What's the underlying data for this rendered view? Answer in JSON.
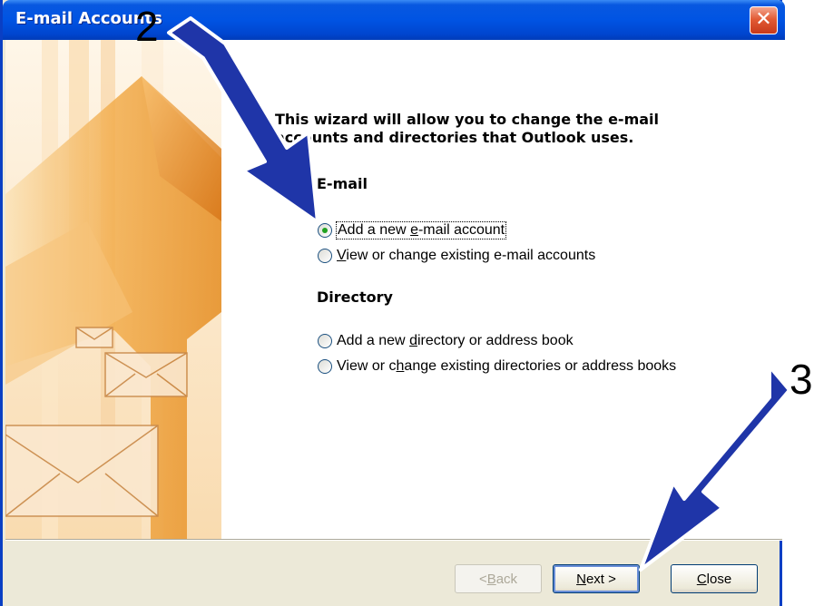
{
  "window": {
    "title": "E-mail Accounts",
    "close_glyph": "✕"
  },
  "intro": {
    "line1": "This wizard will allow you to change the e-mail",
    "line2": "accounts and directories that Outlook uses."
  },
  "email_group": {
    "title": "E-mail",
    "options": [
      {
        "before": "Add a new ",
        "mnemonic": "e",
        "after": "-mail account",
        "checked": true
      },
      {
        "before": "",
        "mnemonic": "V",
        "after": "iew or change existing e-mail accounts",
        "checked": false
      }
    ]
  },
  "directory_group": {
    "title": "Directory",
    "options": [
      {
        "before": "Add a new ",
        "mnemonic": "d",
        "after": "irectory or address book",
        "checked": false
      },
      {
        "before": "View or c",
        "mnemonic": "h",
        "after": "ange existing directories or address books",
        "checked": false
      }
    ]
  },
  "buttons": {
    "back": {
      "before": "< ",
      "mnemonic": "B",
      "after": "ack",
      "enabled": false
    },
    "next": {
      "before": "",
      "mnemonic": "N",
      "after": "ext >",
      "enabled": true
    },
    "close": {
      "before": "",
      "mnemonic": "C",
      "after": "lose",
      "enabled": true
    }
  },
  "annotations": {
    "step_2": "2",
    "step_3": "3",
    "arrow_color": "#1f35a8"
  },
  "colors": {
    "title_bar": "#0054e3",
    "dialog_face": "#ece9d8",
    "art_orange": "#f0a030"
  }
}
